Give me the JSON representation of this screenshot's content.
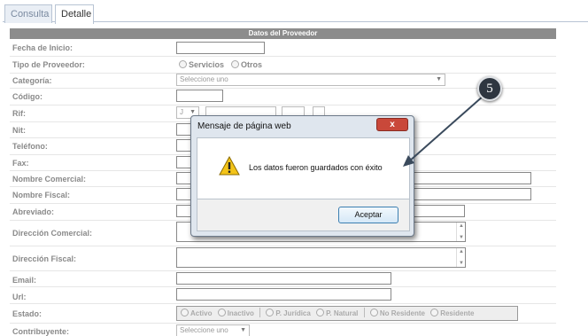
{
  "tabs": [
    {
      "label": "Consulta"
    },
    {
      "label": "Detalle"
    }
  ],
  "section_title": "Datos del Proveedor",
  "fields": {
    "fecha_inicio": "Fecha de Inicio:",
    "tipo_proveedor": "Tipo de Proveedor:",
    "categoria": "Categoría:",
    "codigo": "Código:",
    "rif": "Rif:",
    "nit": "Nit:",
    "telefono": "Teléfono:",
    "fax": "Fax:",
    "nombre_comercial": "Nombre Comercial:",
    "nombre_fiscal": "Nombre Fiscal:",
    "abreviado": "Abreviado:",
    "direccion_comercial": "Dirección Comercial:",
    "direccion_fiscal": "Dirección Fiscal:",
    "email": "Email:",
    "url": "Url:",
    "estado": "Estado:",
    "contribuyente": "Contribuyente:"
  },
  "tipo_options": {
    "servicios": "Servicios",
    "otros": "Otros"
  },
  "categoria_select": {
    "value": "Seleccione uno"
  },
  "rif_prefix": "J",
  "contribuyente_select": {
    "value": "Seleccione uno"
  },
  "estado_options": {
    "activo": "Activo",
    "inactivo": "Inactivo",
    "p_juridica": "P. Jurídica",
    "p_natural": "P. Natural",
    "no_residente": "No Residente",
    "residente": "Residente"
  },
  "dialog": {
    "title": "Mensaje de página web",
    "close": "x",
    "message": "Los datos fueron guardados con éxito",
    "ok_label": "Aceptar"
  },
  "callout": {
    "number": "5"
  },
  "colors": {
    "header": "#8c8c8c",
    "close": "#c9483a",
    "badge": "#2e3640"
  }
}
